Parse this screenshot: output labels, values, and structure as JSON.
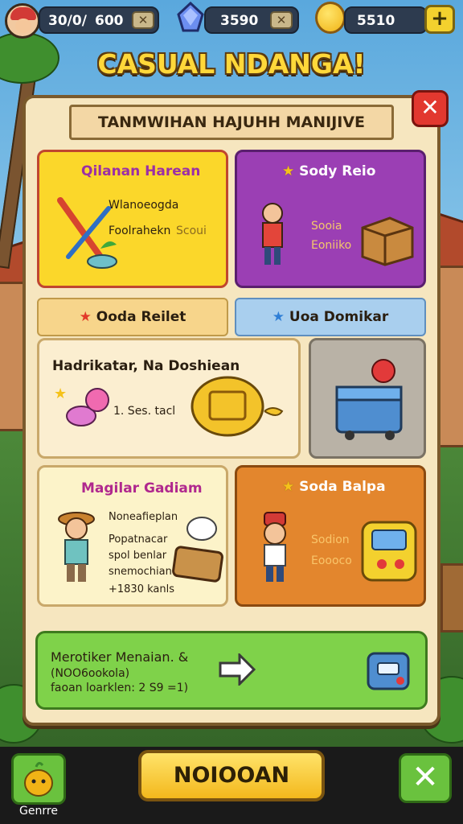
{
  "top_bar": {
    "stat1_value": "30/0/",
    "stat2_value": "600",
    "gems_value": "3590",
    "coins_value": "5510",
    "cancel_glyph": "✕",
    "plus_glyph": "+",
    "icons": [
      "avatar-icon",
      "gem-icon",
      "coin-icon"
    ]
  },
  "game_title": "CASUAL NDANGA!",
  "panel": {
    "banner_title": "TANMWIHAN HAJUHH MANIJIVE",
    "close_glyph": "✕",
    "cards": [
      {
        "title": "Qilanan Harean",
        "lines": [
          "Wlanoeogda",
          "Foolrahekn",
          "Scoui"
        ],
        "bg": "#fbd72a"
      },
      {
        "title": "Sody Reio",
        "lines": [
          "Sooia",
          "Eoniiko"
        ],
        "bg": "#9b3fb4"
      },
      {
        "title": "Hadrikatar, Na Doshiean",
        "lines": [
          "1. Ses. tacl"
        ],
        "bg": "#fbeed0"
      },
      {
        "title": "Magilar Gadiam",
        "lines": [
          "Noneafieplan",
          "Popatnacar",
          "spol benlar",
          "snemochian",
          "+1830 kanls"
        ],
        "bg": "#fcf3c9"
      },
      {
        "title": "Soda Balpa",
        "lines": [
          "Sodion",
          "Eoooco"
        ],
        "bg": "#e3862d"
      }
    ],
    "tabs": [
      {
        "label": "Ooda Reilet",
        "bg": "#f7d58b"
      },
      {
        "label": "Uoa Domikar",
        "bg": "#a9cfee"
      }
    ],
    "promo": {
      "line1": "Merotiker Menaian. &",
      "line2": "(NOO6ookola)",
      "line3": "faoan loarklen: 2 S9 =1)"
    }
  },
  "bottom_bar": {
    "shop_label": "Genrre",
    "main_button_label": "NOIOOAN",
    "ok_glyph": "✕"
  },
  "colors": {
    "accent_yellow": "#fbd72a",
    "accent_green": "#6ac23e",
    "close_red": "#e2382f",
    "title_gold": "#ffd83a"
  }
}
